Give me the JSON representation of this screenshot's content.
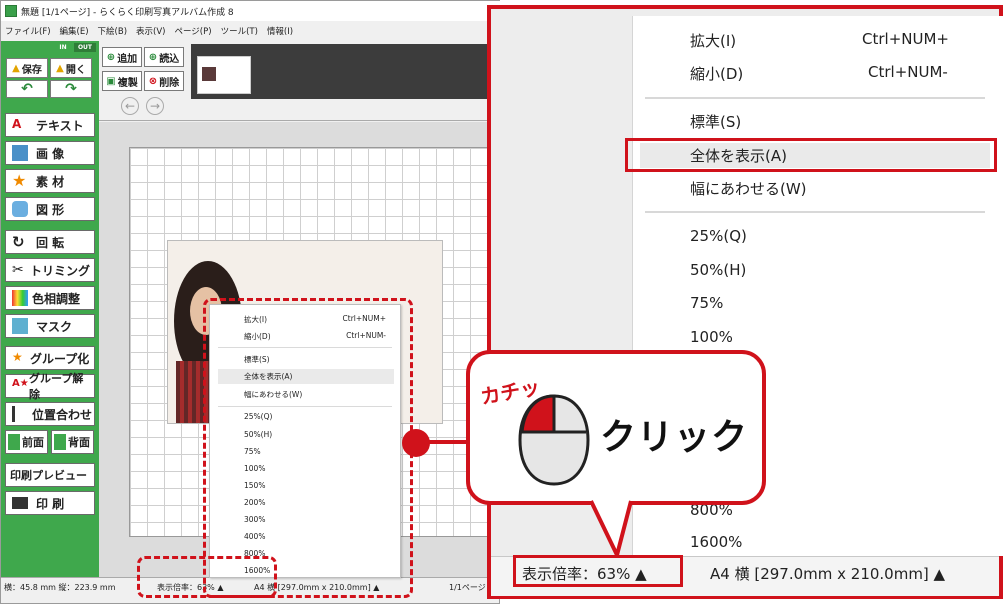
{
  "window": {
    "title": "無題 [1/1ページ] - らくらく印刷写真アルバム作成 8",
    "menus": [
      "ファイル(F)",
      "編集(E)",
      "下絵(B)",
      "表示(V)",
      "ページ(P)",
      "ツール(T)",
      "情報(I)"
    ],
    "toggle_in": "IN",
    "toggle_out": "OUT"
  },
  "toolbar": {
    "save": "保存",
    "open": "開く",
    "add": "追加",
    "read": "読込",
    "duplicate": "複製",
    "delete": "削除"
  },
  "tools": [
    "テキスト",
    "画 像",
    "素 材",
    "図 形",
    "回 転",
    "トリミング",
    "色相調整",
    "マスク",
    "グループ化",
    "グループ解除",
    "位置合わせ",
    "前面",
    "背面",
    "印刷プレビュー",
    "印 刷"
  ],
  "status": {
    "position": "横：45.8 mm  縦：223.9 mm",
    "zoom_small": "表示倍率：63% ▲",
    "paper_small": "A4 横 [297.0mm x 210.0mm] ▲",
    "page": "1/1ページ"
  },
  "small_menu": {
    "items": [
      {
        "label": "拡大(I)",
        "shortcut": "Ctrl+NUM+"
      },
      {
        "label": "縮小(D)",
        "shortcut": "Ctrl+NUM-"
      },
      {
        "label": "標準(S)"
      },
      {
        "label": "全体を表示(A)"
      },
      {
        "label": "幅にあわせる(W)"
      },
      {
        "label": "25%(Q)"
      },
      {
        "label": "50%(H)"
      },
      {
        "label": "75%"
      },
      {
        "label": "100%"
      },
      {
        "label": "150%"
      },
      {
        "label": "200%"
      },
      {
        "label": "300%"
      },
      {
        "label": "400%"
      },
      {
        "label": "800%"
      },
      {
        "label": "1600%"
      }
    ]
  },
  "zoom_menu": {
    "enlarge": "拡大(I)",
    "enlarge_shortcut": "Ctrl+NUM+",
    "shrink": "縮小(D)",
    "shrink_shortcut": "Ctrl+NUM-",
    "standard": "標準(S)",
    "fit_all": "全体を表示(A)",
    "fit_width": "幅にあわせる(W)",
    "p25": "25%(Q)",
    "p50": "50%(H)",
    "p75": "75%",
    "p100": "100%",
    "p800": "800%",
    "p1600": "1600%"
  },
  "zoom_status": {
    "zoom": "表示倍率：63% ▲",
    "paper": "A4 横 [297.0mm x 210.0mm] ▲"
  },
  "callout": {
    "sound": "カチッ",
    "action": "クリック"
  },
  "colors": {
    "accent": "#d0121b",
    "sidebar": "#3fa84c"
  }
}
